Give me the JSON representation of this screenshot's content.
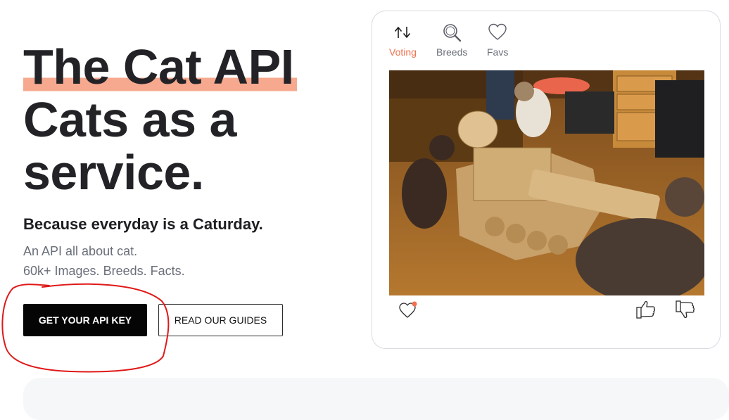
{
  "hero": {
    "title_line1": "The Cat API",
    "title_line2": "Cats as a",
    "title_line3": "service.",
    "tagline": "Because everyday is a Caturday.",
    "desc1": "An API all about cat.",
    "desc2": "60k+ Images. Breeds. Facts."
  },
  "buttons": {
    "primary": "GET YOUR API KEY",
    "secondary": "READ OUR GUIDES"
  },
  "card": {
    "tabs": [
      {
        "label": "Voting",
        "icon": "vote-arrows-icon",
        "active": true
      },
      {
        "label": "Breeds",
        "icon": "search-icon",
        "active": false
      },
      {
        "label": "Favs",
        "icon": "heart-icon",
        "active": false
      }
    ],
    "image_alt": "cats with cardboard tank",
    "actions": [
      "heart-icon",
      "thumbs-up-icon",
      "thumbs-down-icon"
    ]
  },
  "colors": {
    "accent": "#f2704e",
    "highlight": "#f6a98f",
    "annotation": "#e01818"
  }
}
